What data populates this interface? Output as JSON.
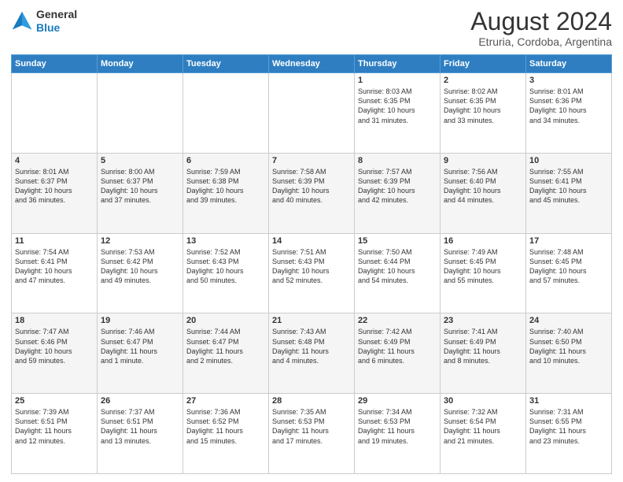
{
  "header": {
    "logo_line1": "General",
    "logo_line2": "Blue",
    "title": "August 2024",
    "subtitle": "Etruria, Cordoba, Argentina"
  },
  "weekdays": [
    "Sunday",
    "Monday",
    "Tuesday",
    "Wednesday",
    "Thursday",
    "Friday",
    "Saturday"
  ],
  "weeks": [
    [
      {
        "day": "",
        "info": ""
      },
      {
        "day": "",
        "info": ""
      },
      {
        "day": "",
        "info": ""
      },
      {
        "day": "",
        "info": ""
      },
      {
        "day": "1",
        "info": "Sunrise: 8:03 AM\nSunset: 6:35 PM\nDaylight: 10 hours\nand 31 minutes."
      },
      {
        "day": "2",
        "info": "Sunrise: 8:02 AM\nSunset: 6:35 PM\nDaylight: 10 hours\nand 33 minutes."
      },
      {
        "day": "3",
        "info": "Sunrise: 8:01 AM\nSunset: 6:36 PM\nDaylight: 10 hours\nand 34 minutes."
      }
    ],
    [
      {
        "day": "4",
        "info": "Sunrise: 8:01 AM\nSunset: 6:37 PM\nDaylight: 10 hours\nand 36 minutes."
      },
      {
        "day": "5",
        "info": "Sunrise: 8:00 AM\nSunset: 6:37 PM\nDaylight: 10 hours\nand 37 minutes."
      },
      {
        "day": "6",
        "info": "Sunrise: 7:59 AM\nSunset: 6:38 PM\nDaylight: 10 hours\nand 39 minutes."
      },
      {
        "day": "7",
        "info": "Sunrise: 7:58 AM\nSunset: 6:39 PM\nDaylight: 10 hours\nand 40 minutes."
      },
      {
        "day": "8",
        "info": "Sunrise: 7:57 AM\nSunset: 6:39 PM\nDaylight: 10 hours\nand 42 minutes."
      },
      {
        "day": "9",
        "info": "Sunrise: 7:56 AM\nSunset: 6:40 PM\nDaylight: 10 hours\nand 44 minutes."
      },
      {
        "day": "10",
        "info": "Sunrise: 7:55 AM\nSunset: 6:41 PM\nDaylight: 10 hours\nand 45 minutes."
      }
    ],
    [
      {
        "day": "11",
        "info": "Sunrise: 7:54 AM\nSunset: 6:41 PM\nDaylight: 10 hours\nand 47 minutes."
      },
      {
        "day": "12",
        "info": "Sunrise: 7:53 AM\nSunset: 6:42 PM\nDaylight: 10 hours\nand 49 minutes."
      },
      {
        "day": "13",
        "info": "Sunrise: 7:52 AM\nSunset: 6:43 PM\nDaylight: 10 hours\nand 50 minutes."
      },
      {
        "day": "14",
        "info": "Sunrise: 7:51 AM\nSunset: 6:43 PM\nDaylight: 10 hours\nand 52 minutes."
      },
      {
        "day": "15",
        "info": "Sunrise: 7:50 AM\nSunset: 6:44 PM\nDaylight: 10 hours\nand 54 minutes."
      },
      {
        "day": "16",
        "info": "Sunrise: 7:49 AM\nSunset: 6:45 PM\nDaylight: 10 hours\nand 55 minutes."
      },
      {
        "day": "17",
        "info": "Sunrise: 7:48 AM\nSunset: 6:45 PM\nDaylight: 10 hours\nand 57 minutes."
      }
    ],
    [
      {
        "day": "18",
        "info": "Sunrise: 7:47 AM\nSunset: 6:46 PM\nDaylight: 10 hours\nand 59 minutes."
      },
      {
        "day": "19",
        "info": "Sunrise: 7:46 AM\nSunset: 6:47 PM\nDaylight: 11 hours\nand 1 minute."
      },
      {
        "day": "20",
        "info": "Sunrise: 7:44 AM\nSunset: 6:47 PM\nDaylight: 11 hours\nand 2 minutes."
      },
      {
        "day": "21",
        "info": "Sunrise: 7:43 AM\nSunset: 6:48 PM\nDaylight: 11 hours\nand 4 minutes."
      },
      {
        "day": "22",
        "info": "Sunrise: 7:42 AM\nSunset: 6:49 PM\nDaylight: 11 hours\nand 6 minutes."
      },
      {
        "day": "23",
        "info": "Sunrise: 7:41 AM\nSunset: 6:49 PM\nDaylight: 11 hours\nand 8 minutes."
      },
      {
        "day": "24",
        "info": "Sunrise: 7:40 AM\nSunset: 6:50 PM\nDaylight: 11 hours\nand 10 minutes."
      }
    ],
    [
      {
        "day": "25",
        "info": "Sunrise: 7:39 AM\nSunset: 6:51 PM\nDaylight: 11 hours\nand 12 minutes."
      },
      {
        "day": "26",
        "info": "Sunrise: 7:37 AM\nSunset: 6:51 PM\nDaylight: 11 hours\nand 13 minutes."
      },
      {
        "day": "27",
        "info": "Sunrise: 7:36 AM\nSunset: 6:52 PM\nDaylight: 11 hours\nand 15 minutes."
      },
      {
        "day": "28",
        "info": "Sunrise: 7:35 AM\nSunset: 6:53 PM\nDaylight: 11 hours\nand 17 minutes."
      },
      {
        "day": "29",
        "info": "Sunrise: 7:34 AM\nSunset: 6:53 PM\nDaylight: 11 hours\nand 19 minutes."
      },
      {
        "day": "30",
        "info": "Sunrise: 7:32 AM\nSunset: 6:54 PM\nDaylight: 11 hours\nand 21 minutes."
      },
      {
        "day": "31",
        "info": "Sunrise: 7:31 AM\nSunset: 6:55 PM\nDaylight: 11 hours\nand 23 minutes."
      }
    ]
  ]
}
